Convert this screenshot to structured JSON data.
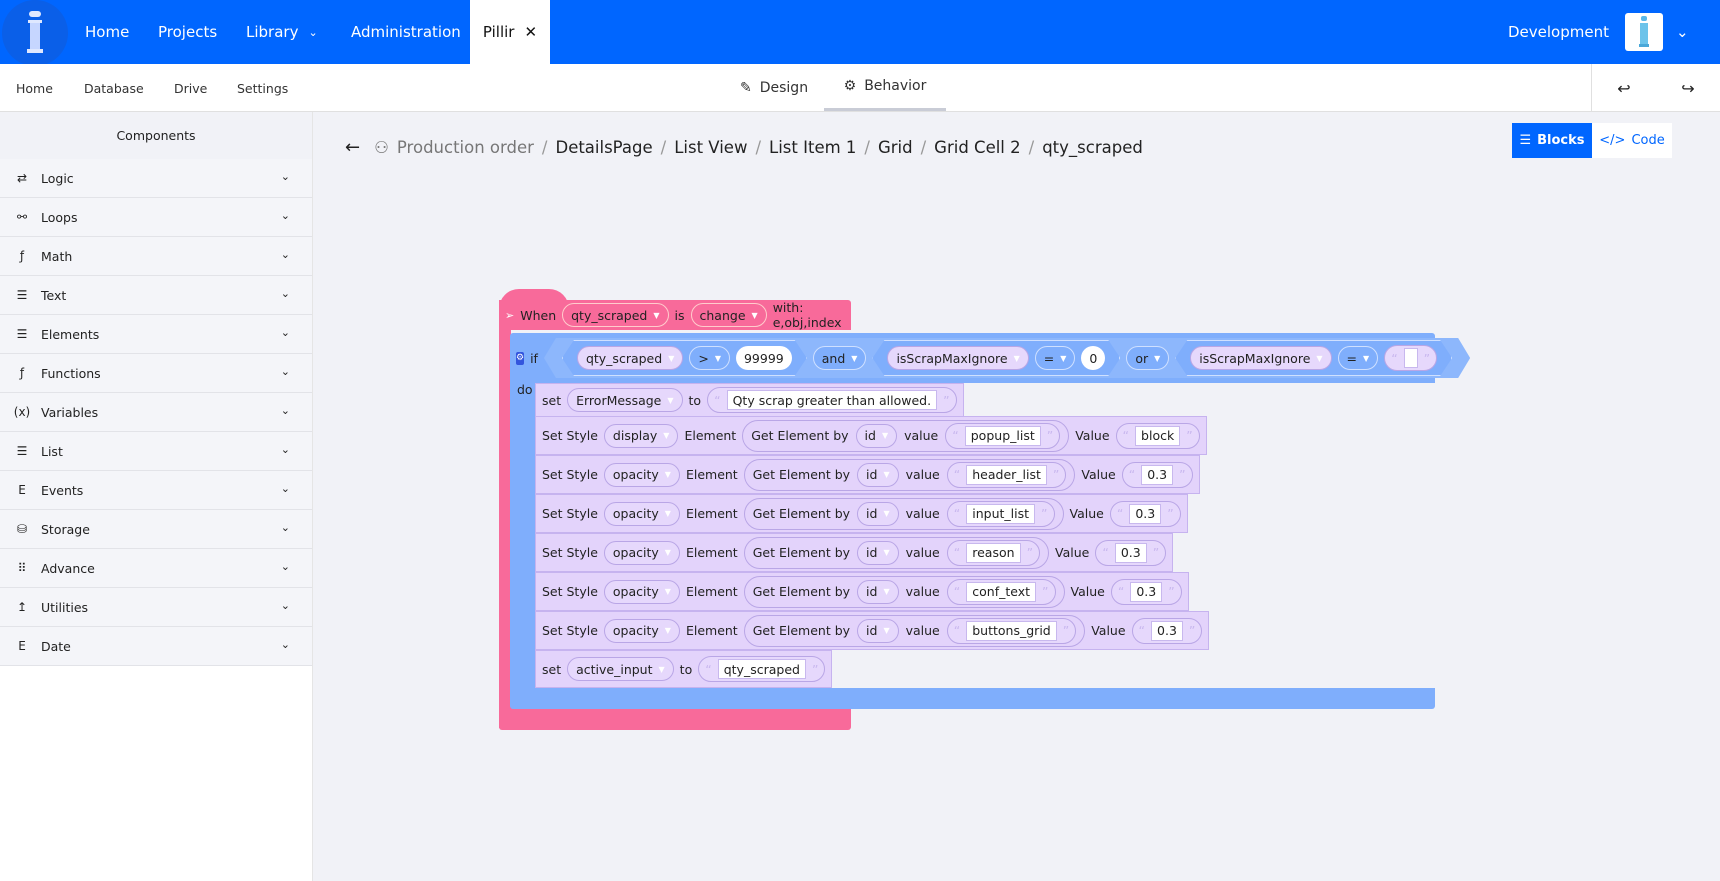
{
  "topbar": {
    "nav": [
      "Home",
      "Projects",
      "Library",
      "Administration"
    ],
    "open_tab": "Pillir",
    "environment": "Development",
    "brand_color": "#0066ff"
  },
  "subbar": {
    "items": [
      "Home",
      "Database",
      "Drive",
      "Settings"
    ],
    "tabs": [
      "Design",
      "Behavior"
    ],
    "active_tab": "Behavior"
  },
  "sidebar": {
    "title": "Components",
    "items": [
      {
        "label": "Logic",
        "icon": "⇄"
      },
      {
        "label": "Loops",
        "icon": "⚯"
      },
      {
        "label": "Math",
        "icon": "ƒ"
      },
      {
        "label": "Text",
        "icon": "☰"
      },
      {
        "label": "Elements",
        "icon": "☰"
      },
      {
        "label": "Functions",
        "icon": "ƒ"
      },
      {
        "label": "Variables",
        "icon": "(x)"
      },
      {
        "label": "List",
        "icon": "☰"
      },
      {
        "label": "Events",
        "icon": "E"
      },
      {
        "label": "Storage",
        "icon": "⛁"
      },
      {
        "label": "Advance",
        "icon": "⠿"
      },
      {
        "label": "Utilities",
        "icon": "↥"
      },
      {
        "label": "Date",
        "icon": "E"
      }
    ]
  },
  "breadcrumb": [
    "Production order",
    "DetailsPage",
    "List View",
    "List Item 1",
    "Grid",
    "Grid Cell 2",
    "qty_scraped"
  ],
  "view_toggle": {
    "blocks": "Blocks",
    "code": "Code",
    "active": "Blocks"
  },
  "blocks": {
    "event": {
      "when": "When",
      "component": "qty_scraped",
      "is": "is",
      "event": "change",
      "with": "with: e,obj,index"
    },
    "if": {
      "if": "if",
      "do": "do",
      "left_var": "qty_scraped",
      "op1": ">",
      "num": "99999",
      "and": "and",
      "var2": "isScrapMaxIgnore",
      "op2": "=",
      "num2": "0",
      "or": "or",
      "var3": "isScrapMaxIgnore",
      "op3": "=",
      "str3": ""
    },
    "set_error": {
      "set": "set",
      "var": "ErrorMessage",
      "to": "to",
      "value": "Qty scrap greater than allowed."
    },
    "set_styles": [
      {
        "prop": "display",
        "id": "popup_list",
        "value": "block"
      },
      {
        "prop": "opacity",
        "id": "header_list",
        "value": "0.3"
      },
      {
        "prop": "opacity",
        "id": "input_list",
        "value": "0.3"
      },
      {
        "prop": "opacity",
        "id": "reason",
        "value": "0.3"
      },
      {
        "prop": "opacity",
        "id": "conf_text",
        "value": "0.3"
      },
      {
        "prop": "opacity",
        "id": "buttons_grid",
        "value": "0.3"
      }
    ],
    "style_labels": {
      "set_style": "Set Style",
      "element": "Element",
      "get_by": "Get Element by",
      "by": "id",
      "value_lc": "value",
      "value_uc": "Value"
    },
    "set_active": {
      "set": "set",
      "var": "active_input",
      "to": "to",
      "value": "qty_scraped"
    }
  }
}
